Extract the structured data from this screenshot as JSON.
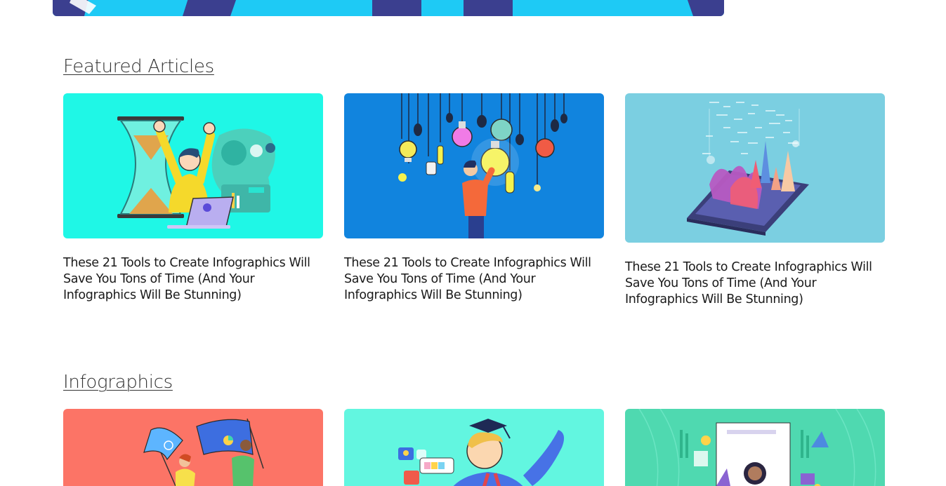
{
  "hero": {
    "colors": {
      "base": "#1ecaf5",
      "stripe": "#3b3f8f"
    }
  },
  "sections": {
    "featured": {
      "heading": "Featured Articles",
      "cards": [
        {
          "title": "These 21 Tools to Create Infographics Will Save You Tons of Time (And Your Infographics Will Be Stunning)",
          "thumb_bg": "#1ff7e6",
          "thumb_icon": "hourglass-celebration-illustration"
        },
        {
          "title": "These 21 Tools to Create Infographics Will Save You Tons of Time (And Your Infographics Will Be Stunning)",
          "thumb_bg": "#1184de",
          "thumb_icon": "hanging-lightbulbs-illustration"
        },
        {
          "title": "These 21 Tools to Create Infographics Will Save You Tons of Time (And Your Infographics Will Be Stunning)",
          "thumb_bg": "#7bcfe1",
          "thumb_icon": "tablet-3d-chart-illustration"
        }
      ]
    },
    "infographics": {
      "heading": "Infographics",
      "cards": [
        {
          "thumb_bg": "#fc7466",
          "thumb_icon": "runners-with-flags-illustration"
        },
        {
          "thumb_bg": "#62f6e0",
          "thumb_icon": "graduate-illustration"
        },
        {
          "thumb_bg": "#4fd9b0",
          "thumb_icon": "document-woman-illustration"
        }
      ]
    }
  }
}
